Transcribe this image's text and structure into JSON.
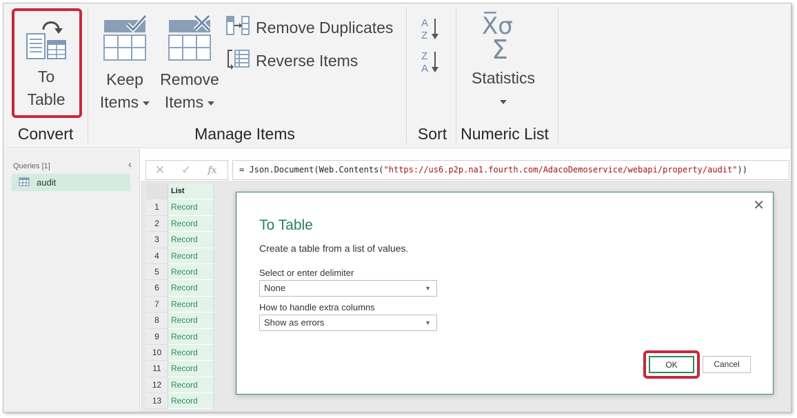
{
  "ribbon": {
    "groups": {
      "convert": "Convert",
      "manage_items": "Manage Items",
      "sort": "Sort",
      "numeric_list": "Numeric List"
    },
    "to_table": {
      "line1": "To",
      "line2": "Table"
    },
    "keep_items": {
      "line1": "Keep",
      "line2": "Items"
    },
    "remove_items": {
      "line1": "Remove",
      "line2": "Items"
    },
    "remove_duplicates": "Remove Duplicates",
    "reverse_items": "Reverse Items",
    "statistics": "Statistics",
    "sigma_glyph": "Σ",
    "xsigma_glyph": "X̅σ"
  },
  "queries": {
    "title": "Queries [1]",
    "items": [
      {
        "label": "audit"
      }
    ]
  },
  "formula_bar": {
    "prefix": "= Json.Document(Web.Contents(",
    "url": "\"https://us6.p2p.na1.fourth.com/AdacoDemoservice/webapi/property/audit\"",
    "suffix": "))",
    "fx": "fx"
  },
  "grid": {
    "column_header": "List",
    "rows": [
      {
        "n": "1",
        "v": "Record"
      },
      {
        "n": "2",
        "v": "Record"
      },
      {
        "n": "3",
        "v": "Record"
      },
      {
        "n": "4",
        "v": "Record"
      },
      {
        "n": "5",
        "v": "Record"
      },
      {
        "n": "6",
        "v": "Record"
      },
      {
        "n": "7",
        "v": "Record"
      },
      {
        "n": "8",
        "v": "Record"
      },
      {
        "n": "9",
        "v": "Record"
      },
      {
        "n": "10",
        "v": "Record"
      },
      {
        "n": "11",
        "v": "Record"
      },
      {
        "n": "12",
        "v": "Record"
      },
      {
        "n": "13",
        "v": "Record"
      }
    ]
  },
  "dialog": {
    "title": "To Table",
    "description": "Create a table from a list of values.",
    "delimiter_label": "Select or enter delimiter",
    "delimiter_value": "None",
    "extra_columns_label": "How to handle extra columns",
    "extra_columns_value": "Show as errors",
    "ok": "OK",
    "cancel": "Cancel"
  },
  "colors": {
    "highlight": "#c8283c",
    "accent_green": "#2e8b57",
    "ribbon_bg": "#f3f3f3"
  }
}
